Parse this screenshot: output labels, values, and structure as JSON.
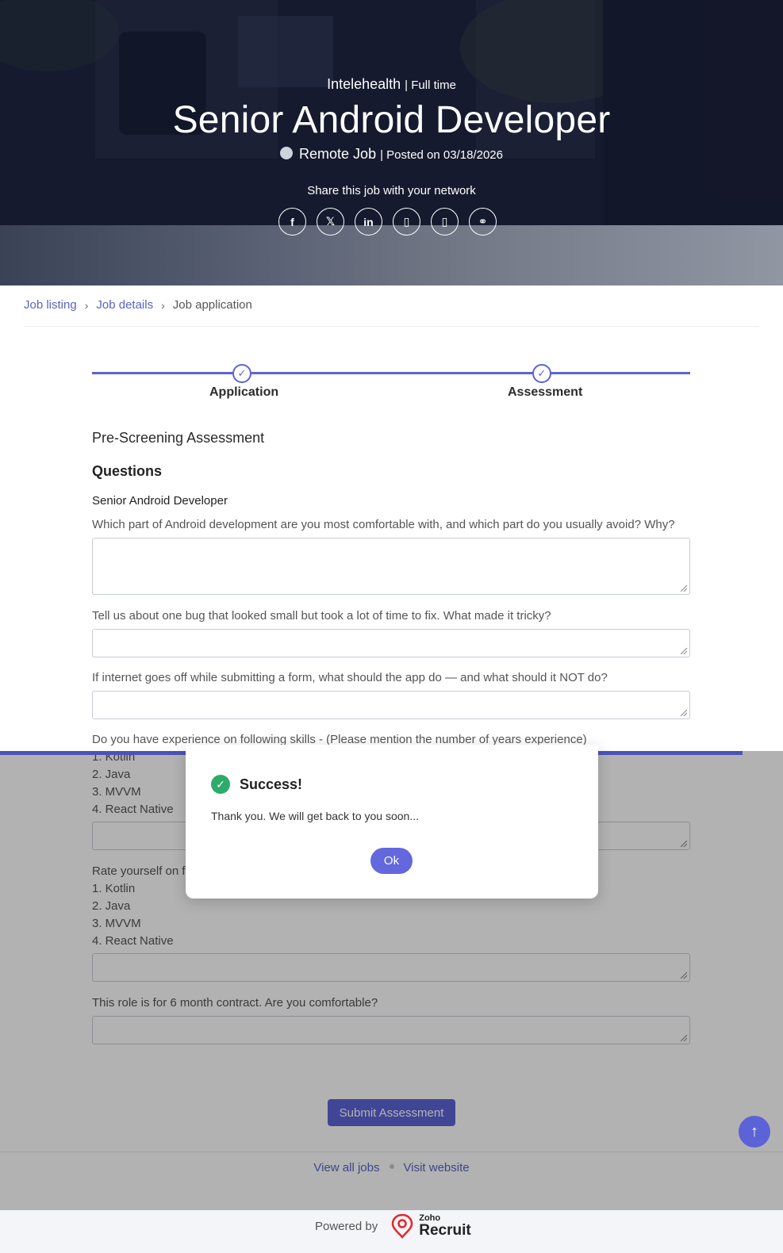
{
  "header": {
    "company": "Intelehealth",
    "job_type": "| Full time",
    "title": "Senior Android Developer",
    "location": "Remote Job",
    "posted": "| Posted on 03/18/2026",
    "share_label": "Share this job with your network",
    "share_icons": [
      "facebook-icon",
      "x-icon",
      "linkedin-icon",
      "share-icon",
      "share-icon",
      "link-icon"
    ],
    "share_glyphs": [
      "f",
      "𝕏",
      "in",
      "▯",
      "▯",
      "⚭"
    ]
  },
  "breadcrumb": {
    "job_listing": "Job listing",
    "job_details": "Job details",
    "current": "Job application",
    "separator": "›"
  },
  "stepper": {
    "step1": "Application",
    "step2": "Assessment",
    "check": "✓"
  },
  "form": {
    "section_title": "Pre-Screening Assessment",
    "questions_title": "Questions",
    "form_name": "Senior Android Developer",
    "questions": [
      "Which part of Android development are you most comfortable with, and which part do you usually avoid? Why?",
      "Tell us about one bug that looked small but took a lot of time to fix. What made it tricky?",
      "If internet goes off while submitting a form, what should the app do — and what should it NOT do?",
      "Do you have experience on following skills - (Please mention the number of years experience)",
      "Rate yourself on f",
      "This role is for 6 month contract. Are you comfortable?"
    ],
    "skills_1": [
      "1. Kotlin",
      "2. Java",
      "3. MVVM",
      "4. React Native"
    ],
    "skills_2": [
      "1. Kotlin",
      "2. Java",
      "3. MVVM",
      "4. React Native"
    ],
    "submit_label": "Submit Assessment"
  },
  "footer": {
    "view_all_jobs": "View all jobs",
    "visit_website": "Visit website",
    "powered_by": "Powered by",
    "logo_zoho": "Zoho",
    "logo_recruit": "Recruit"
  },
  "scroll_top_glyph": "↑",
  "modal": {
    "title": "Success!",
    "check": "✓",
    "message": "Thank you. We will get back to you soon...",
    "ok_label": "Ok"
  },
  "colors": {
    "accent": "#5c63d6",
    "link": "#5a63c4",
    "success": "#2eaa6a"
  }
}
